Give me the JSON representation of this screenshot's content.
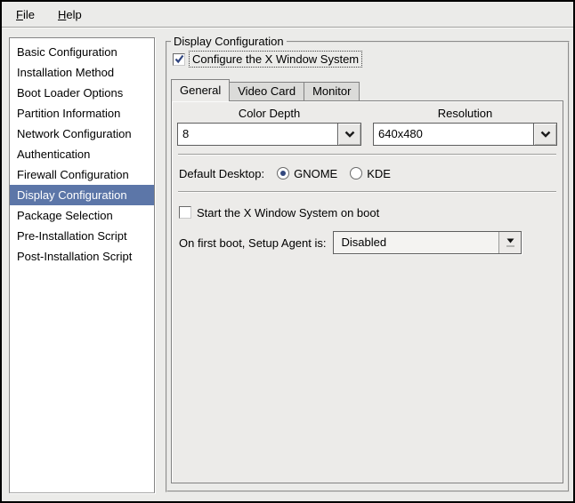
{
  "menubar": {
    "file": {
      "accel": "F",
      "rest": "ile"
    },
    "help": {
      "accel": "H",
      "rest": "elp"
    }
  },
  "sidebar": {
    "items": [
      "Basic Configuration",
      "Installation Method",
      "Boot Loader Options",
      "Partition Information",
      "Network Configuration",
      "Authentication",
      "Firewall Configuration",
      "Display Configuration",
      "Package Selection",
      "Pre-Installation Script",
      "Post-Installation Script"
    ],
    "selected": "Display Configuration",
    "selected_index": 7
  },
  "display_config": {
    "frame_title": "Display Configuration",
    "configure_x": {
      "label": "Configure the X Window System",
      "checked": true
    },
    "tabs": [
      {
        "label": "General",
        "active": true
      },
      {
        "label": "Video Card",
        "active": false
      },
      {
        "label": "Monitor",
        "active": false
      }
    ],
    "general": {
      "color_depth": {
        "label": "Color Depth",
        "value": "8"
      },
      "resolution": {
        "label": "Resolution",
        "value": "640x480"
      },
      "default_desktop": {
        "label": "Default Desktop:",
        "options": [
          {
            "label": "GNOME",
            "selected": true
          },
          {
            "label": "KDE",
            "selected": false
          }
        ]
      },
      "start_x": {
        "label": "Start the X Window System on boot",
        "checked": false
      },
      "setup_agent": {
        "label": "On first boot, Setup Agent is:",
        "value": "Disabled"
      }
    }
  },
  "colors": {
    "window_bg": "#ebebe9",
    "selection": "#5c76a8",
    "check_mark": "#30457f"
  }
}
